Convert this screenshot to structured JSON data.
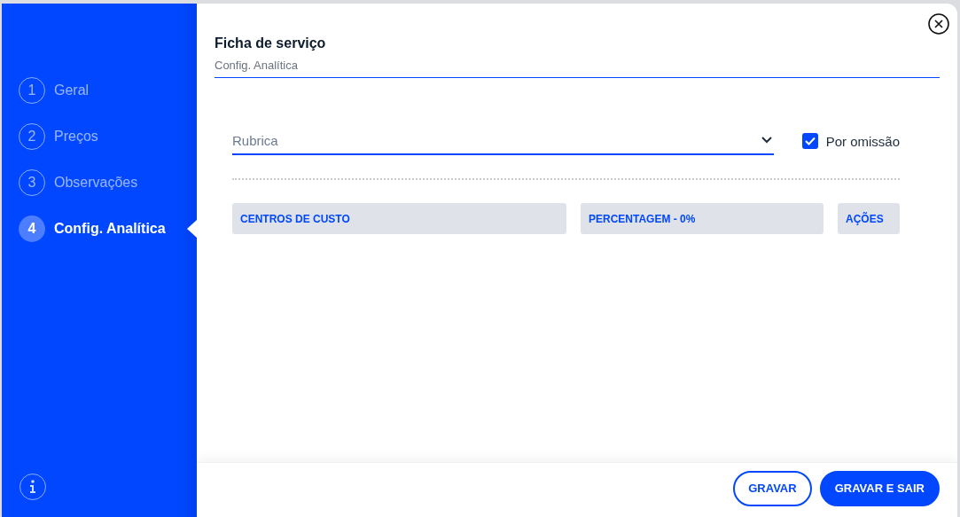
{
  "sidebar": {
    "steps": [
      {
        "number": "1",
        "label": "Geral",
        "selected": false
      },
      {
        "number": "2",
        "label": "Preços",
        "selected": false
      },
      {
        "number": "3",
        "label": "Observações",
        "selected": false
      },
      {
        "number": "4",
        "label": "Config. Analítica",
        "selected": true
      }
    ]
  },
  "header": {
    "title": "Ficha de serviço",
    "subtitle": "Config. Analítica"
  },
  "form": {
    "rubrica": {
      "placeholder": "Rubrica"
    },
    "default_checkbox": {
      "label": "Por omissão",
      "checked": true
    }
  },
  "table": {
    "columns": [
      "CENTROS DE CUSTO",
      "PERCENTAGEM - 0%",
      "AÇÕES"
    ]
  },
  "footer": {
    "buttons": [
      {
        "label": "GRAVAR",
        "kind": "outline"
      },
      {
        "label": "GRAVAR E SAIR",
        "kind": "primary"
      }
    ]
  }
}
